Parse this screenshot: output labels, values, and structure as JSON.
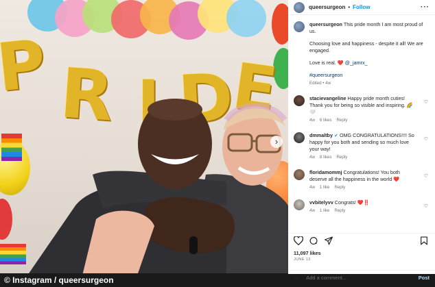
{
  "header": {
    "username": "queersurgeon",
    "separator": "•",
    "follow_label": "Follow",
    "more_icon": "more-horizontal-icon"
  },
  "caption": {
    "username": "queersurgeon",
    "line1": "This pride month I am most proud of us.",
    "line2": "Choosing love and happiness - despite it all! We are engaged.",
    "line3": "Love is real.",
    "heart": "❤️",
    "mention": "@_jamrx_",
    "hashtag": "#queersurgeon",
    "meta": "Edited • 4w"
  },
  "comments": [
    {
      "username": "stacievangeline",
      "text": "Happy pride month cuties! Thank you for being so visible and inspiring. 🌈🤍",
      "age": "4w",
      "likes": "6 likes",
      "reply": "Reply",
      "verified": false
    },
    {
      "username": "dmmaltby",
      "text": "OMG CONGRATULATIONS!!!! So happy for you both and sending so much love your way!",
      "age": "4w",
      "likes": "8 likes",
      "reply": "Reply",
      "verified": true
    },
    {
      "username": "floridamommj",
      "text": "Congratulations! You both deserve all the happiness in the world ❤️",
      "age": "4w",
      "likes": "1 like",
      "reply": "Reply",
      "verified": false
    },
    {
      "username": "vvbitelyvv",
      "text": "Congrats! ❤️‼️",
      "age": "4w",
      "likes": "1 like",
      "reply": "Reply",
      "verified": false
    }
  ],
  "actions": {
    "like_icon": "heart-icon",
    "comment_icon": "comment-icon",
    "share_icon": "share-icon",
    "save_icon": "bookmark-icon"
  },
  "likes": "11,097 likes",
  "date": "JUNE 13",
  "add_comment": {
    "emoji_icon": "emoji-icon",
    "placeholder": "Add a comment...",
    "post_label": "Post"
  },
  "photo": {
    "banner_text": "PRIDE",
    "carousel_icon": "chevron-right-icon"
  },
  "watermark": "© Instagram / queersurgeon",
  "colors": {
    "accent": "#0095f6",
    "balloon_gold": "#e2b529",
    "like_red": "#ed4956"
  }
}
